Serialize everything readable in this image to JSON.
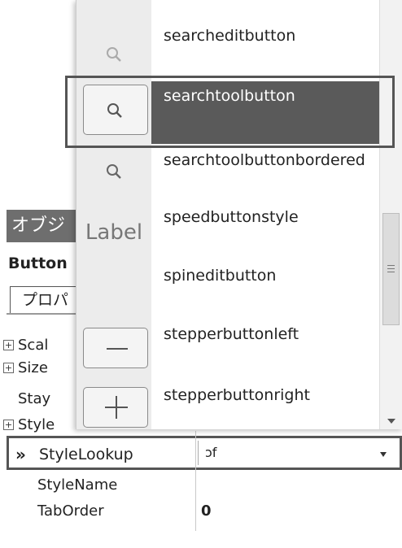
{
  "inspector": {
    "title": "オブジ",
    "object_name": "Button",
    "tab_label": "プロパ",
    "props": [
      {
        "name": "Scal",
        "expandable": true,
        "value": ""
      },
      {
        "name": "Size",
        "expandable": true,
        "value": ""
      },
      {
        "name": "Stay",
        "expandable": false,
        "value": ""
      },
      {
        "name": "Style",
        "expandable": true,
        "value": ""
      }
    ],
    "selected_prop": {
      "arrow": "»",
      "name": "StyleLookup",
      "value": "ɔf"
    },
    "after_props": [
      {
        "name": "StyleName",
        "value": ""
      },
      {
        "name": "TabOrder",
        "value": "0"
      }
    ]
  },
  "popup": {
    "items": [
      {
        "label": "searcheditbutton",
        "preview": "search-icon"
      },
      {
        "label": "searchtoolbutton",
        "preview": "search-icon",
        "selected": true
      },
      {
        "label": "searchtoolbuttonbordered",
        "preview": "search-icon"
      },
      {
        "label": "speedbuttonstyle",
        "preview": "label-text"
      },
      {
        "label": "spineditbutton",
        "preview": "label-text"
      },
      {
        "label": "stepperbuttonleft",
        "preview": "minus-icon"
      },
      {
        "label": "stepperbuttonright",
        "preview": "plus-icon"
      }
    ],
    "preview_label": "Label"
  }
}
